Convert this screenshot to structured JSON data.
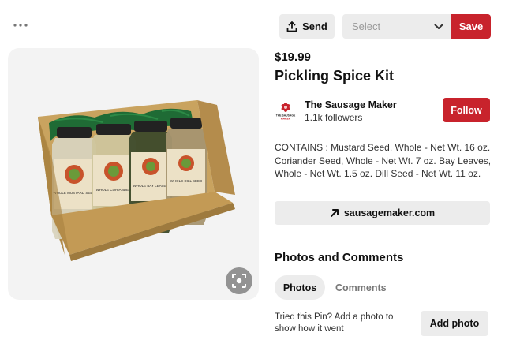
{
  "toolbar": {
    "more_icon": "ellipsis-icon",
    "send_label": "Send",
    "send_icon": "share-upload-icon",
    "board_select_placeholder": "Select",
    "board_select_icon": "chevron-down-icon",
    "save_label": "Save"
  },
  "pin": {
    "image_alt": "Pickling spice kit box with four spice bottles",
    "bottle_labels": [
      "WHOLE MUSTARD SEED",
      "WHOLE CORIANDER",
      "WHOLE BAY LEAVES",
      "WHOLE DILL SEED"
    ],
    "lens_icon": "visual-search-icon",
    "price": "$19.99",
    "title": "Pickling Spice Kit",
    "description": "CONTAINS : Mustard Seed, Whole - Net Wt. 16 oz. Coriander Seed, Whole - Net Wt. 7 oz. Bay Leaves, Whole - Net Wt. 1.5 oz. Dill Seed - Net Wt. 11 oz.",
    "link_label": "sausagemaker.com",
    "link_icon": "arrow-up-right-icon"
  },
  "creator": {
    "name": "The Sausage Maker",
    "followers": "1.1k followers",
    "logo_text_1": "THE SAUSAGE",
    "logo_text_2": "MAKER",
    "follow_label": "Follow"
  },
  "comments_section": {
    "heading": "Photos and Comments",
    "tabs": [
      {
        "label": "Photos",
        "active": true
      },
      {
        "label": "Comments",
        "active": false
      }
    ],
    "try_prompt": "Tried this Pin? Add a photo to show how it went",
    "add_photo_label": "Add photo"
  },
  "colors": {
    "accent_red": "#c8232c",
    "button_gray": "#ececec",
    "image_bg": "#f3f3f3"
  }
}
